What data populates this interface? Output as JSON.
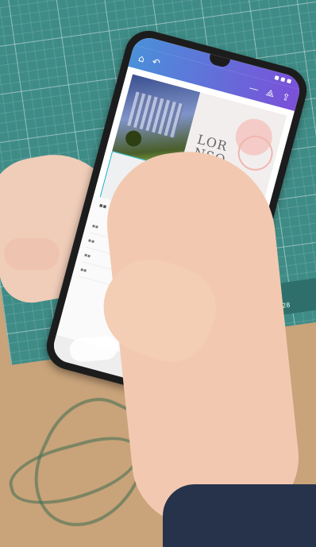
{
  "scene": {
    "description_colors": {
      "mat": "#3f8c87",
      "desk": "#c9a37a",
      "skin": "#f2c9b0",
      "sleeve": "#27334a",
      "app_header_start": "#4a90d9",
      "app_header_end": "#7b4fd9"
    }
  },
  "app": {
    "toolbar": {
      "left_icons": [
        "home-icon",
        "undo-icon"
      ],
      "right_icons": [
        "minus-icon",
        "share-icon",
        "upload-icon"
      ]
    },
    "design": {
      "text_line1": "LOR",
      "text_line2": "NSO"
    }
  },
  "mat_ruler": {
    "label": "26 27 28"
  }
}
